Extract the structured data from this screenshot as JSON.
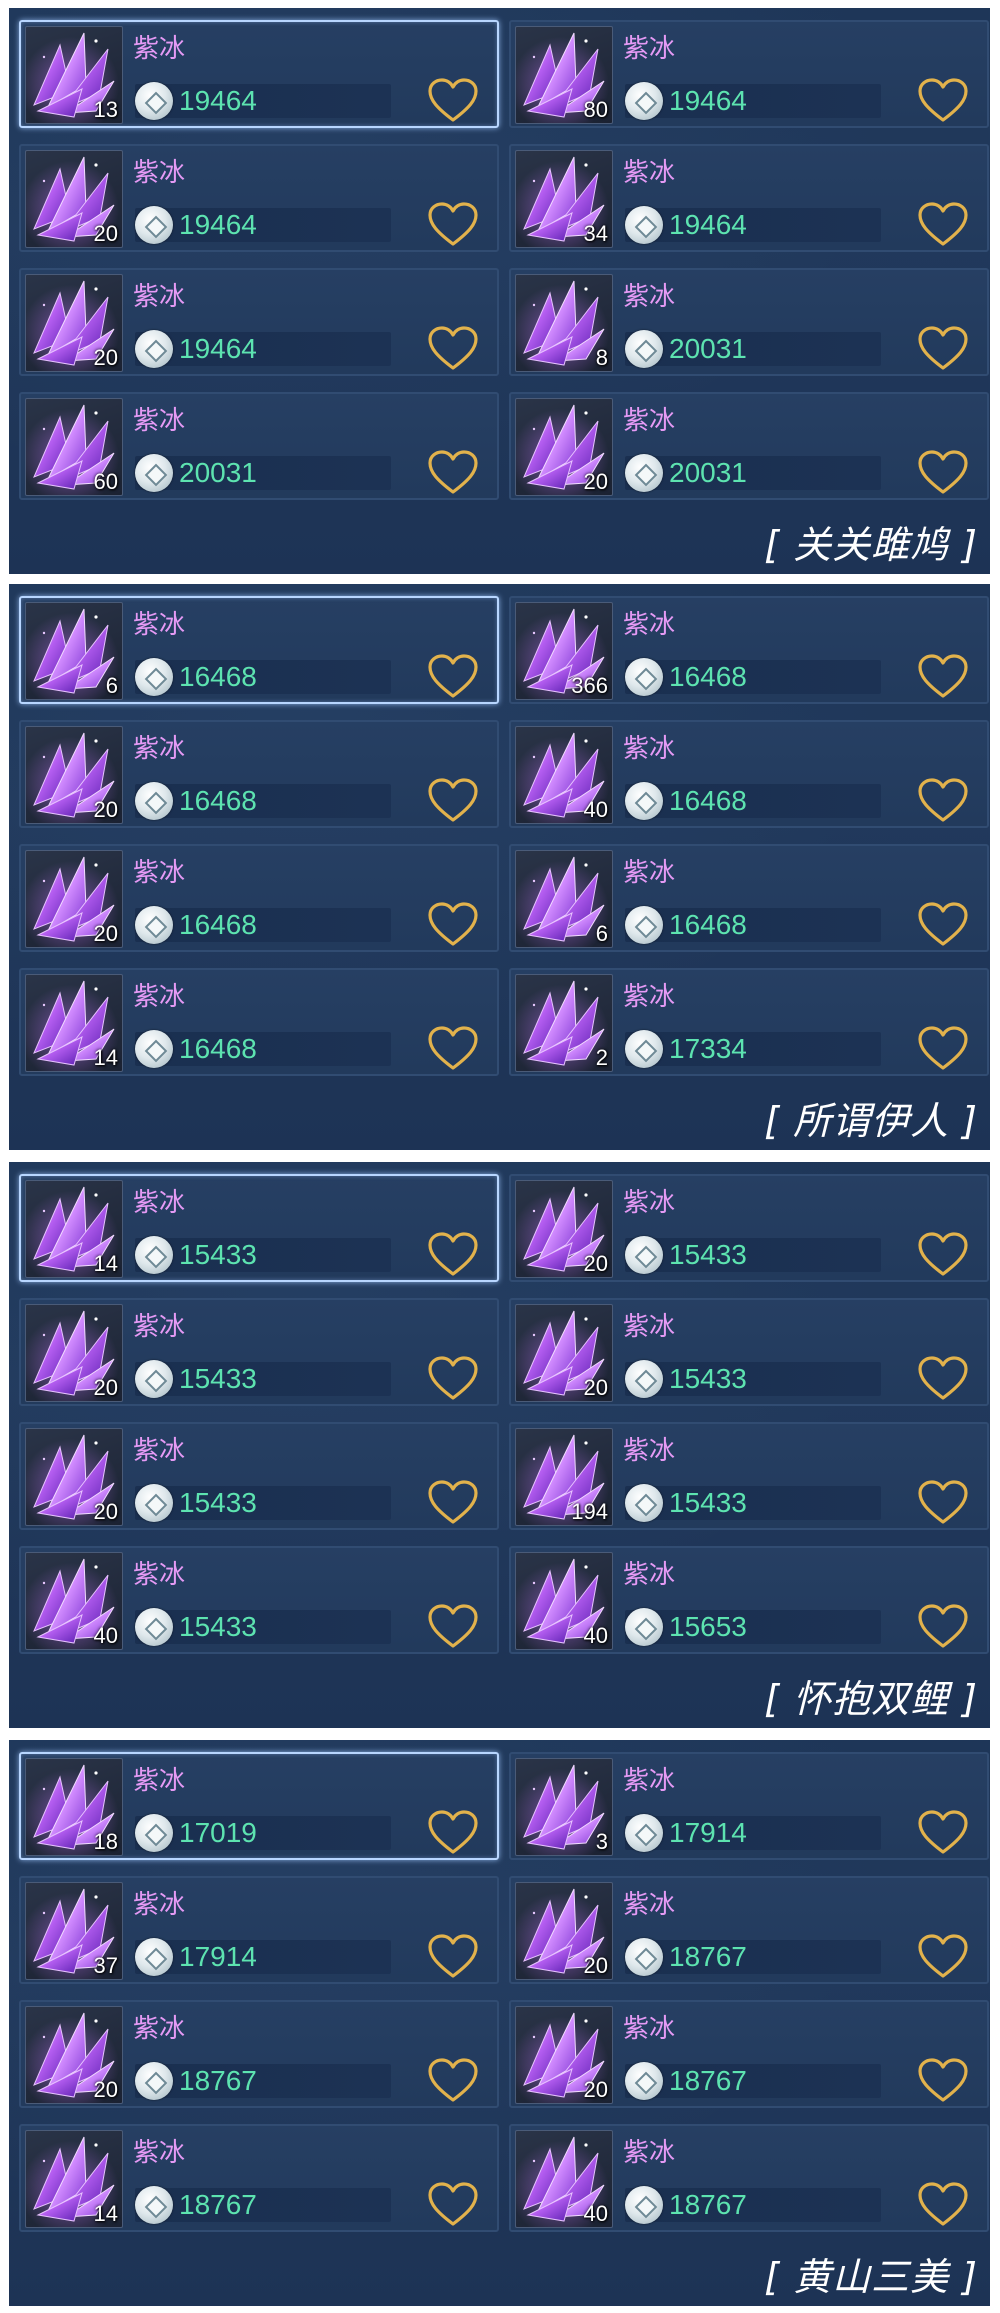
{
  "item_name": "紫冰",
  "icon_names": {
    "thumb": "crystal-icon",
    "coin": "coin-icon",
    "favorite": "heart-outline-icon"
  },
  "colors": {
    "name": "#e59af5",
    "price": "#5de3b0",
    "heart": "#e2b24c",
    "panel": "#1e3658"
  },
  "panels": [
    {
      "title": "[ 关关雎鸠 ]",
      "items": [
        {
          "count": "13",
          "price": "19464",
          "selected": true
        },
        {
          "count": "80",
          "price": "19464",
          "selected": false
        },
        {
          "count": "20",
          "price": "19464",
          "selected": false
        },
        {
          "count": "34",
          "price": "19464",
          "selected": false
        },
        {
          "count": "20",
          "price": "19464",
          "selected": false
        },
        {
          "count": "8",
          "price": "20031",
          "selected": false
        },
        {
          "count": "60",
          "price": "20031",
          "selected": false
        },
        {
          "count": "20",
          "price": "20031",
          "selected": false
        }
      ]
    },
    {
      "title": "[ 所谓伊人 ]",
      "items": [
        {
          "count": "6",
          "price": "16468",
          "selected": true
        },
        {
          "count": "366",
          "price": "16468",
          "selected": false
        },
        {
          "count": "20",
          "price": "16468",
          "selected": false
        },
        {
          "count": "40",
          "price": "16468",
          "selected": false
        },
        {
          "count": "20",
          "price": "16468",
          "selected": false
        },
        {
          "count": "6",
          "price": "16468",
          "selected": false
        },
        {
          "count": "14",
          "price": "16468",
          "selected": false
        },
        {
          "count": "2",
          "price": "17334",
          "selected": false
        }
      ]
    },
    {
      "title": "[ 怀抱双鲤 ]",
      "items": [
        {
          "count": "14",
          "price": "15433",
          "selected": true
        },
        {
          "count": "20",
          "price": "15433",
          "selected": false
        },
        {
          "count": "20",
          "price": "15433",
          "selected": false
        },
        {
          "count": "20",
          "price": "15433",
          "selected": false
        },
        {
          "count": "20",
          "price": "15433",
          "selected": false
        },
        {
          "count": "194",
          "price": "15433",
          "selected": false
        },
        {
          "count": "40",
          "price": "15433",
          "selected": false
        },
        {
          "count": "40",
          "price": "15653",
          "selected": false
        }
      ]
    },
    {
      "title": "[ 黄山三美 ]",
      "items": [
        {
          "count": "18",
          "price": "17019",
          "selected": true
        },
        {
          "count": "3",
          "price": "17914",
          "selected": false
        },
        {
          "count": "37",
          "price": "17914",
          "selected": false
        },
        {
          "count": "20",
          "price": "18767",
          "selected": false
        },
        {
          "count": "20",
          "price": "18767",
          "selected": false
        },
        {
          "count": "20",
          "price": "18767",
          "selected": false
        },
        {
          "count": "14",
          "price": "18767",
          "selected": false
        },
        {
          "count": "40",
          "price": "18767",
          "selected": false
        }
      ]
    }
  ]
}
